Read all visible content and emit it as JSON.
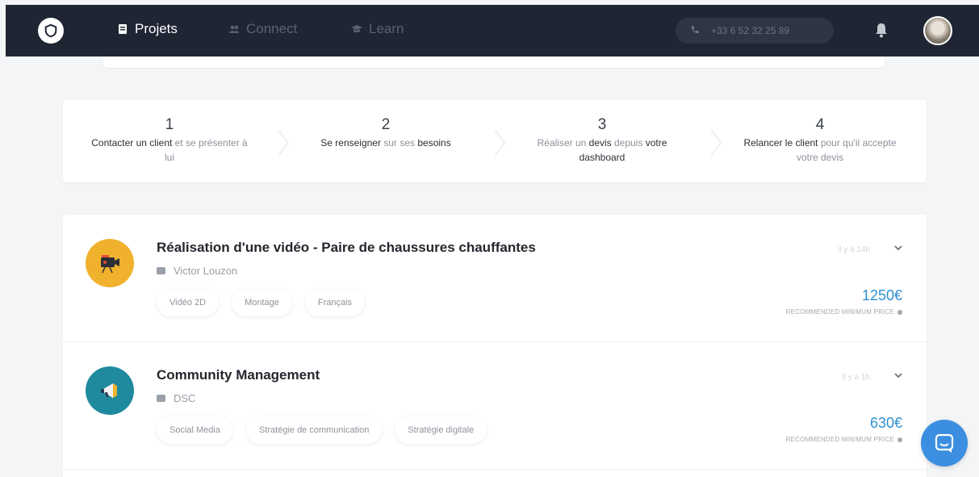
{
  "navbar": {
    "items": [
      {
        "label": "Projets",
        "icon": "clipboard-icon",
        "active": true
      },
      {
        "label": "Connect",
        "icon": "users-icon",
        "active": false
      },
      {
        "label": "Learn",
        "icon": "graduation-cap-icon",
        "active": false
      }
    ],
    "phone": "+33 6 52 32 25 89",
    "bell_icon": "bell-icon",
    "avatar_icon": "user-avatar"
  },
  "steps": [
    {
      "number": "1",
      "parts": [
        {
          "t": "Contacter un client",
          "b": true
        },
        {
          "t": " et se présenter à lui",
          "b": false
        }
      ]
    },
    {
      "number": "2",
      "parts": [
        {
          "t": "Se renseigner",
          "b": true
        },
        {
          "t": " sur ses ",
          "b": false
        },
        {
          "t": "besoins",
          "b": true
        }
      ]
    },
    {
      "number": "3",
      "parts": [
        {
          "t": "Réaliser un ",
          "b": false
        },
        {
          "t": "devis",
          "b": true
        },
        {
          "t": " depuis ",
          "b": false
        },
        {
          "t": "votre dashboard",
          "b": true
        }
      ]
    },
    {
      "number": "4",
      "parts": [
        {
          "t": "Relancer le client",
          "b": true
        },
        {
          "t": " pour qu'il accepte votre devis",
          "b": false
        }
      ]
    }
  ],
  "projects": [
    {
      "title": "Réalisation d'une vidéo - Paire de chaussures chauffantes",
      "client": "Victor Louzon",
      "tags": [
        "Vidéo 2D",
        "Montage",
        "Français"
      ],
      "time": "il y a 14h",
      "price": "1250€",
      "price_label": "RECOMMENDED MINIMUM PRICE",
      "icon": "video-camera-icon",
      "color": "#f0b12c"
    },
    {
      "title": "Community Management",
      "client": "DSC",
      "tags": [
        "Social Media",
        "Stratégie de communication",
        "Stratégie digitale"
      ],
      "time": "il y a 1h",
      "price": "630€",
      "price_label": "RECOMMENDED MINIMUM PRICE",
      "icon": "megaphone-icon",
      "color": "#1f8a9e"
    }
  ],
  "colors": {
    "navbar": "#1f2533",
    "accent": "#2f8fd1",
    "chat": "#3c8fe0"
  }
}
